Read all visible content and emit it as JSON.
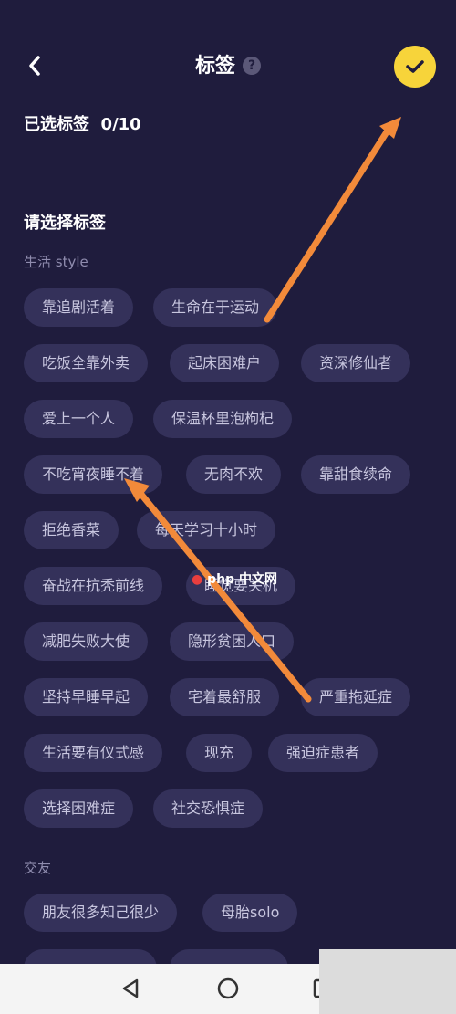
{
  "header": {
    "title": "标签",
    "help_glyph": "?"
  },
  "selected": {
    "label": "已选标签",
    "count": "0/10"
  },
  "choose_label": "请选择标签",
  "sections": {
    "life": {
      "title": "生活 style",
      "tags": [
        "靠追剧活着",
        "生命在于运动",
        "吃饭全靠外卖",
        "起床困难户",
        "资深修仙者",
        "爱上一个人",
        "保温杯里泡枸杞",
        "不吃宵夜睡不着",
        "无肉不欢",
        "靠甜食续命",
        "拒绝香菜",
        "每天学习十小时",
        "奋战在抗秃前线",
        "睡觉要关机",
        "减肥失败大使",
        "隐形贫困人口",
        "坚持早睡早起",
        "宅着最舒服",
        "严重拖延症",
        "生活要有仪式感",
        "现充",
        "强迫症患者",
        "选择困难症",
        "社交恐惧症"
      ]
    },
    "friends": {
      "title": "交友",
      "tags": [
        "朋友很多知己很少",
        "母胎solo"
      ]
    }
  },
  "watermark": {
    "brand": "php",
    "site": "中文网"
  },
  "colors": {
    "background": "#1f1c3d",
    "tag_bg": "#34315a",
    "accent": "#f7d43a",
    "arrow": "#f28a3a"
  }
}
